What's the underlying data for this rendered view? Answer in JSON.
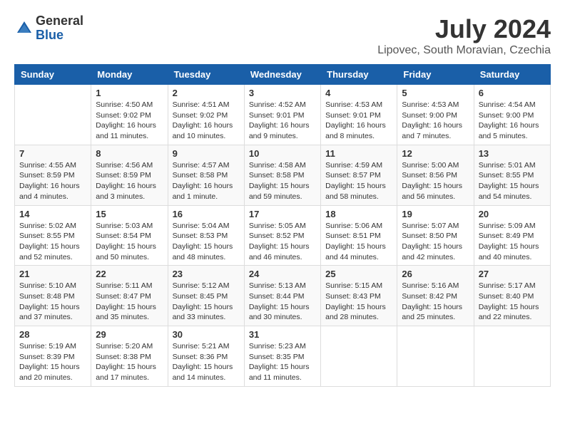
{
  "header": {
    "logo_general": "General",
    "logo_blue": "Blue",
    "month_title": "July 2024",
    "location": "Lipovec, South Moravian, Czechia"
  },
  "weekdays": [
    "Sunday",
    "Monday",
    "Tuesday",
    "Wednesday",
    "Thursday",
    "Friday",
    "Saturday"
  ],
  "weeks": [
    [
      {
        "day": "",
        "info": ""
      },
      {
        "day": "1",
        "info": "Sunrise: 4:50 AM\nSunset: 9:02 PM\nDaylight: 16 hours\nand 11 minutes."
      },
      {
        "day": "2",
        "info": "Sunrise: 4:51 AM\nSunset: 9:02 PM\nDaylight: 16 hours\nand 10 minutes."
      },
      {
        "day": "3",
        "info": "Sunrise: 4:52 AM\nSunset: 9:01 PM\nDaylight: 16 hours\nand 9 minutes."
      },
      {
        "day": "4",
        "info": "Sunrise: 4:53 AM\nSunset: 9:01 PM\nDaylight: 16 hours\nand 8 minutes."
      },
      {
        "day": "5",
        "info": "Sunrise: 4:53 AM\nSunset: 9:00 PM\nDaylight: 16 hours\nand 7 minutes."
      },
      {
        "day": "6",
        "info": "Sunrise: 4:54 AM\nSunset: 9:00 PM\nDaylight: 16 hours\nand 5 minutes."
      }
    ],
    [
      {
        "day": "7",
        "info": "Sunrise: 4:55 AM\nSunset: 8:59 PM\nDaylight: 16 hours\nand 4 minutes."
      },
      {
        "day": "8",
        "info": "Sunrise: 4:56 AM\nSunset: 8:59 PM\nDaylight: 16 hours\nand 3 minutes."
      },
      {
        "day": "9",
        "info": "Sunrise: 4:57 AM\nSunset: 8:58 PM\nDaylight: 16 hours\nand 1 minute."
      },
      {
        "day": "10",
        "info": "Sunrise: 4:58 AM\nSunset: 8:58 PM\nDaylight: 15 hours\nand 59 minutes."
      },
      {
        "day": "11",
        "info": "Sunrise: 4:59 AM\nSunset: 8:57 PM\nDaylight: 15 hours\nand 58 minutes."
      },
      {
        "day": "12",
        "info": "Sunrise: 5:00 AM\nSunset: 8:56 PM\nDaylight: 15 hours\nand 56 minutes."
      },
      {
        "day": "13",
        "info": "Sunrise: 5:01 AM\nSunset: 8:55 PM\nDaylight: 15 hours\nand 54 minutes."
      }
    ],
    [
      {
        "day": "14",
        "info": "Sunrise: 5:02 AM\nSunset: 8:55 PM\nDaylight: 15 hours\nand 52 minutes."
      },
      {
        "day": "15",
        "info": "Sunrise: 5:03 AM\nSunset: 8:54 PM\nDaylight: 15 hours\nand 50 minutes."
      },
      {
        "day": "16",
        "info": "Sunrise: 5:04 AM\nSunset: 8:53 PM\nDaylight: 15 hours\nand 48 minutes."
      },
      {
        "day": "17",
        "info": "Sunrise: 5:05 AM\nSunset: 8:52 PM\nDaylight: 15 hours\nand 46 minutes."
      },
      {
        "day": "18",
        "info": "Sunrise: 5:06 AM\nSunset: 8:51 PM\nDaylight: 15 hours\nand 44 minutes."
      },
      {
        "day": "19",
        "info": "Sunrise: 5:07 AM\nSunset: 8:50 PM\nDaylight: 15 hours\nand 42 minutes."
      },
      {
        "day": "20",
        "info": "Sunrise: 5:09 AM\nSunset: 8:49 PM\nDaylight: 15 hours\nand 40 minutes."
      }
    ],
    [
      {
        "day": "21",
        "info": "Sunrise: 5:10 AM\nSunset: 8:48 PM\nDaylight: 15 hours\nand 37 minutes."
      },
      {
        "day": "22",
        "info": "Sunrise: 5:11 AM\nSunset: 8:47 PM\nDaylight: 15 hours\nand 35 minutes."
      },
      {
        "day": "23",
        "info": "Sunrise: 5:12 AM\nSunset: 8:45 PM\nDaylight: 15 hours\nand 33 minutes."
      },
      {
        "day": "24",
        "info": "Sunrise: 5:13 AM\nSunset: 8:44 PM\nDaylight: 15 hours\nand 30 minutes."
      },
      {
        "day": "25",
        "info": "Sunrise: 5:15 AM\nSunset: 8:43 PM\nDaylight: 15 hours\nand 28 minutes."
      },
      {
        "day": "26",
        "info": "Sunrise: 5:16 AM\nSunset: 8:42 PM\nDaylight: 15 hours\nand 25 minutes."
      },
      {
        "day": "27",
        "info": "Sunrise: 5:17 AM\nSunset: 8:40 PM\nDaylight: 15 hours\nand 22 minutes."
      }
    ],
    [
      {
        "day": "28",
        "info": "Sunrise: 5:19 AM\nSunset: 8:39 PM\nDaylight: 15 hours\nand 20 minutes."
      },
      {
        "day": "29",
        "info": "Sunrise: 5:20 AM\nSunset: 8:38 PM\nDaylight: 15 hours\nand 17 minutes."
      },
      {
        "day": "30",
        "info": "Sunrise: 5:21 AM\nSunset: 8:36 PM\nDaylight: 15 hours\nand 14 minutes."
      },
      {
        "day": "31",
        "info": "Sunrise: 5:23 AM\nSunset: 8:35 PM\nDaylight: 15 hours\nand 11 minutes."
      },
      {
        "day": "",
        "info": ""
      },
      {
        "day": "",
        "info": ""
      },
      {
        "day": "",
        "info": ""
      }
    ]
  ]
}
